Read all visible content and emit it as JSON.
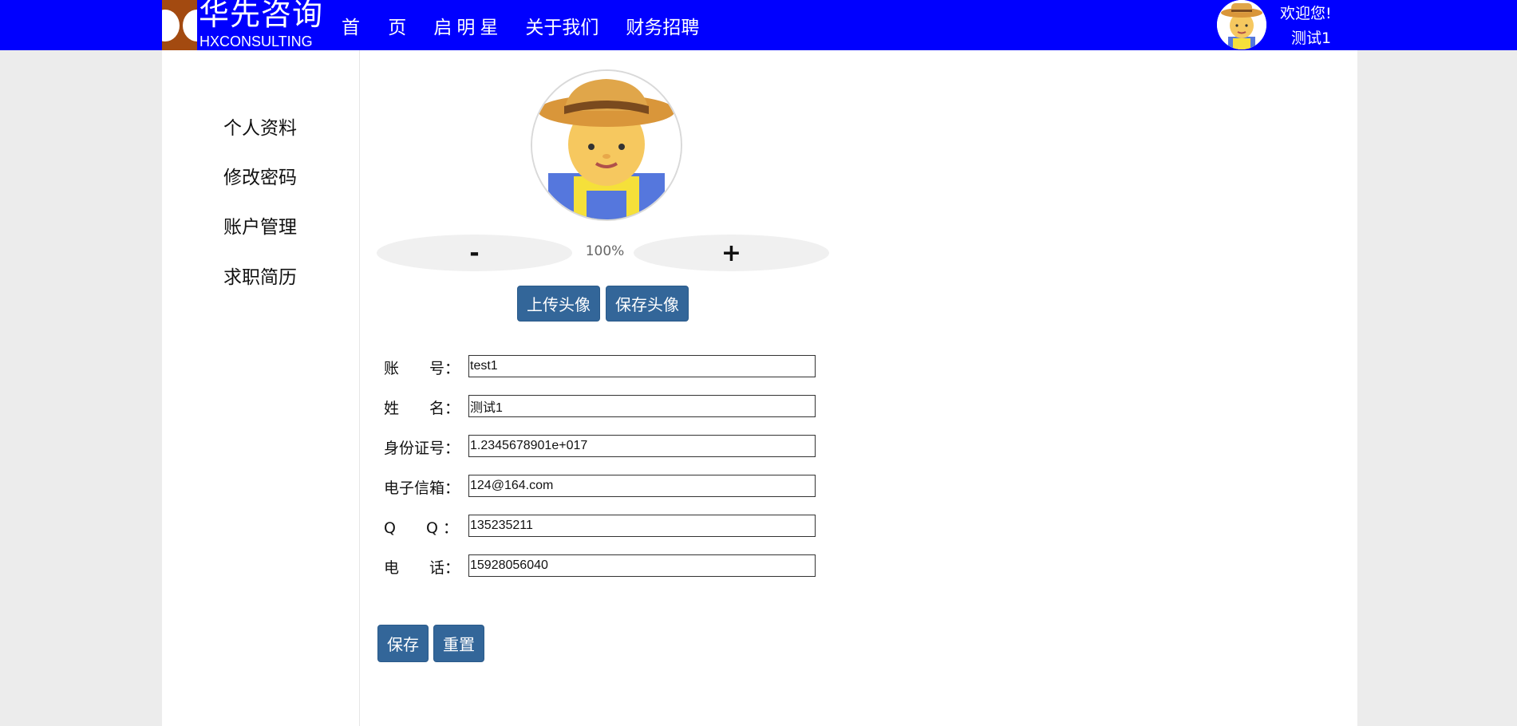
{
  "header": {
    "logo_cn": "华先咨询",
    "logo_en": "HXCONSULTING",
    "nav": [
      {
        "label": "首 页"
      },
      {
        "label": "启明星"
      },
      {
        "label": "关于我们"
      },
      {
        "label": "财务招聘"
      }
    ],
    "welcome": "欢迎您!",
    "username": "测试1"
  },
  "sidebar": {
    "items": [
      {
        "label": "个人资料"
      },
      {
        "label": "修改密码"
      },
      {
        "label": "账户管理"
      },
      {
        "label": "求职简历"
      }
    ]
  },
  "avatar_editor": {
    "zoom_out": "-",
    "zoom_in": "+",
    "zoom_level": "100%",
    "upload_label": "上传头像",
    "save_label": "保存头像"
  },
  "form": {
    "fields": [
      {
        "label": "账　　号：",
        "value": "test1"
      },
      {
        "label": "姓　　名：",
        "value": "测试1"
      },
      {
        "label": "身份证号：",
        "value": "1.2345678901e+017"
      },
      {
        "label": "电子信箱：",
        "value": "124@164.com"
      },
      {
        "label": "Q　　Q ：",
        "value": "135235211"
      },
      {
        "label": "电　　话：",
        "value": "15928056040"
      }
    ],
    "save_label": "保存",
    "reset_label": "重置"
  },
  "colors": {
    "header_bg": "#0000ff",
    "button_bg": "#336699",
    "page_bg": "#ececec"
  }
}
